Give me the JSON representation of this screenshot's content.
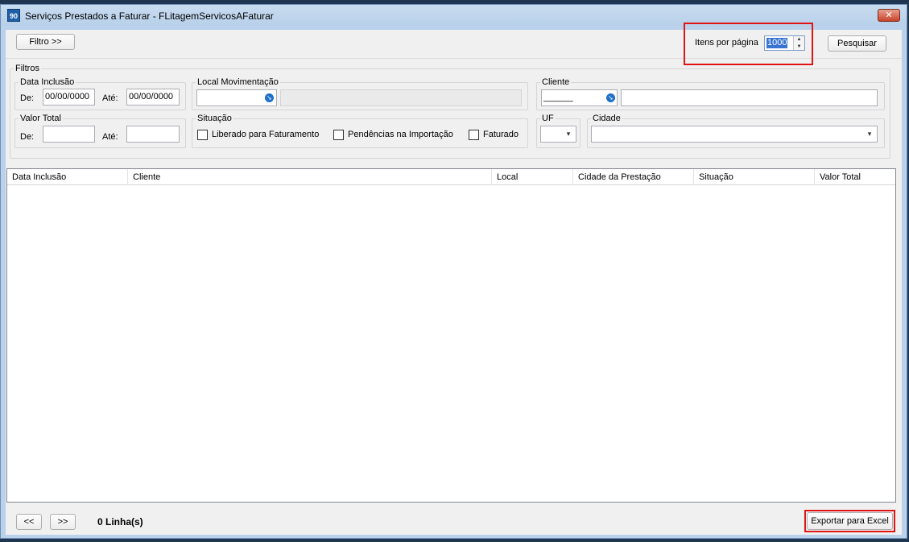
{
  "window": {
    "title": "Serviços Prestados a Faturar - FLitagemServicosAFaturar",
    "app_icon_text": "90",
    "close_glyph": "✕"
  },
  "toolbar": {
    "filter_toggle_label": "Filtro >>",
    "items_per_page_label": "Itens por página",
    "items_per_page_value": "1000",
    "search_label": "Pesquisar"
  },
  "filters": {
    "title": "Filtros",
    "data_inclusao": {
      "title": "Data Inclusão",
      "from_label": "De:",
      "from_value": "00/00/0000",
      "to_label": "Até:",
      "to_value": "00/00/0000"
    },
    "local_movimentacao": {
      "title": "Local Movimentação",
      "code_value": "",
      "description_value": ""
    },
    "cliente": {
      "title": "Cliente",
      "code_value": "______",
      "name_value": ""
    },
    "valor_total": {
      "title": "Valor Total",
      "from_label": "De:",
      "from_value": "",
      "to_label": "Até:",
      "to_value": ""
    },
    "situacao": {
      "title": "Situação",
      "options": [
        {
          "label": "Liberado para Faturamento",
          "checked": false
        },
        {
          "label": "Pendências na Importação",
          "checked": false
        },
        {
          "label": "Faturado",
          "checked": false
        }
      ]
    },
    "uf": {
      "title": "UF",
      "selected": ""
    },
    "cidade": {
      "title": "Cidade",
      "selected": ""
    }
  },
  "grid": {
    "columns": [
      "Data Inclusão",
      "Cliente",
      "Local",
      "Cidade da Prestação",
      "Situação",
      "Valor Total"
    ],
    "rows": []
  },
  "footer": {
    "prev_label": "<<",
    "next_label": ">>",
    "row_count": "0 Linha(s)",
    "export_label": "Exportar para Excel"
  },
  "colors": {
    "highlight_border": "#e01414",
    "selection": "#3874d0",
    "lookup_icon": "#1e6fc8"
  }
}
